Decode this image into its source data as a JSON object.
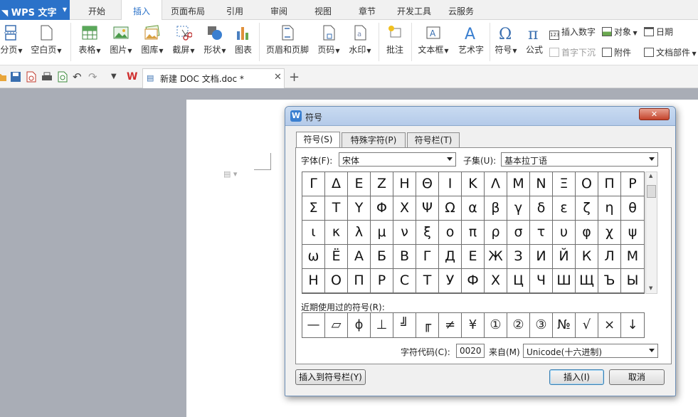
{
  "app": {
    "name": "WPS 文字"
  },
  "ribbon_tabs": [
    "开始",
    "插入",
    "页面布局",
    "引用",
    "审阅",
    "视图",
    "章节",
    "开发工具",
    "云服务"
  ],
  "ribbon": {
    "page_break": "分页",
    "blank_page": "空白页",
    "table": "表格",
    "picture": "图片",
    "gallery": "图库",
    "screenshot": "截屏",
    "shapes": "形状",
    "chart": "图表",
    "header_footer": "页眉和页脚",
    "page_number": "页码",
    "watermark": "水印",
    "comment": "批注",
    "text_box": "文本框",
    "word_art": "艺术字",
    "symbol": "符号",
    "formula": "公式",
    "insert_number": "插入数字",
    "drop_cap": "首字下沉",
    "object": "对象",
    "attachment": "附件",
    "date": "日期",
    "doc_parts": "文档部件"
  },
  "document_tab": {
    "name": "新建 DOC 文档.doc *"
  },
  "dialog": {
    "title": "符号",
    "tabs": [
      "符号(S)",
      "特殊字符(P)",
      "符号栏(T)"
    ],
    "font_label": "字体(F):",
    "font_value": "宋体",
    "subset_label": "子集(U):",
    "subset_value": "基本拉丁语",
    "symbol_rows": [
      [
        "Γ",
        "Δ",
        "Ε",
        "Ζ",
        "Η",
        "Θ",
        "Ι",
        "Κ",
        "Λ",
        "Μ",
        "Ν",
        "Ξ",
        "Ο",
        "Π",
        "Ρ"
      ],
      [
        "Σ",
        "Τ",
        "Υ",
        "Φ",
        "Χ",
        "Ψ",
        "Ω",
        "α",
        "β",
        "γ",
        "δ",
        "ε",
        "ζ",
        "η",
        "θ"
      ],
      [
        "ι",
        "κ",
        "λ",
        "μ",
        "ν",
        "ξ",
        "ο",
        "π",
        "ρ",
        "σ",
        "τ",
        "υ",
        "φ",
        "χ",
        "ψ"
      ],
      [
        "ω",
        "Ё",
        "А",
        "Б",
        "В",
        "Г",
        "Д",
        "Е",
        "Ж",
        "З",
        "И",
        "Й",
        "К",
        "Л",
        "М"
      ],
      [
        "Н",
        "О",
        "П",
        "Р",
        "С",
        "Т",
        "У",
        "Ф",
        "Х",
        "Ц",
        "Ч",
        "Ш",
        "Щ",
        "Ъ",
        "Ы"
      ]
    ],
    "recent_label": "近期使用过的符号(R):",
    "recent_symbols": [
      "—",
      "▱",
      "ϕ",
      "⊥",
      "╝",
      "╓",
      "≠",
      "¥",
      "①",
      "②",
      "③",
      "№",
      "√",
      "×",
      "↓"
    ],
    "char_code_label": "字符代码(C):",
    "char_code_value": "0020",
    "from_label": "来自(M)",
    "from_value": "Unicode(十六进制)",
    "insert_to_bar_button": "插入到符号栏(Y)",
    "insert_button": "插入(I)",
    "cancel_button": "取消"
  },
  "colors": {
    "accent": "#2b72c9",
    "workspace": "#a9adb6"
  }
}
